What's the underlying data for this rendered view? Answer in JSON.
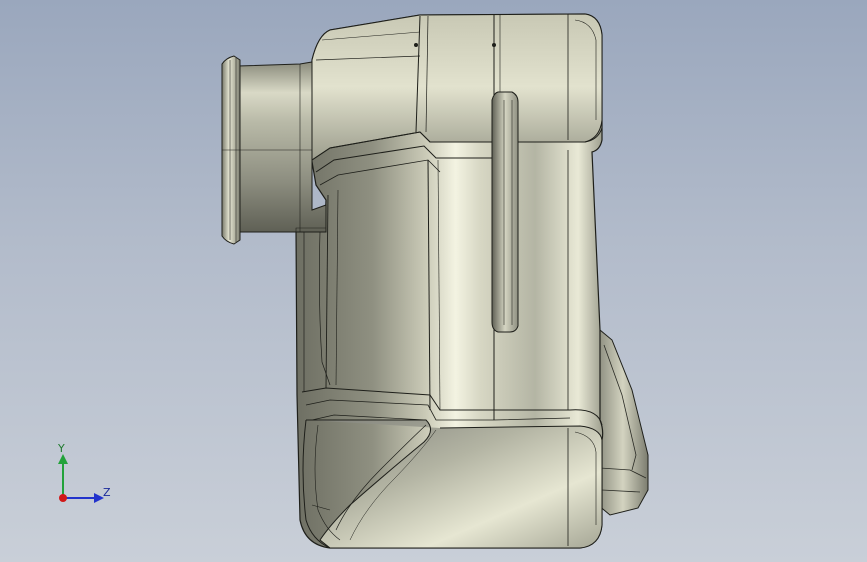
{
  "viewport": {
    "background_top": "#9aa7bd",
    "background_bottom": "#c9cfd8"
  },
  "model": {
    "body_color": "#a6a797",
    "highlight_color": "#f1f1df",
    "edge_color": "#1e1f1a"
  },
  "triad": {
    "y_label": "Y",
    "z_label": "Z",
    "y_color": "#22a23a",
    "z_color": "#2233cc",
    "x_color": "#d01818"
  }
}
